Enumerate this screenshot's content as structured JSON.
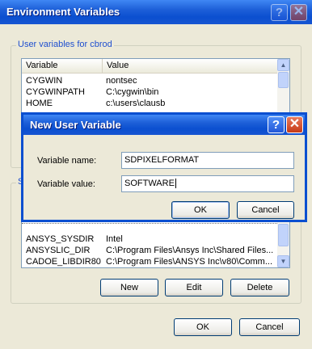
{
  "main_window": {
    "title": "Environment Variables",
    "help_glyph": "?",
    "close_glyph": "✕",
    "user_group_title": "User variables for cbrod",
    "user_columns": [
      "Variable",
      "Value"
    ],
    "user_rows": [
      {
        "variable": "CYGWIN",
        "value": "nontsec"
      },
      {
        "variable": "CYGWINPATH",
        "value": "C:\\cygwin\\bin"
      },
      {
        "variable": "HOME",
        "value": "c:\\users\\clausb"
      }
    ],
    "system_group_title": "Sy",
    "system_rows": [
      {
        "variable": "ANSYS_SYSDIR",
        "value": "Intel"
      },
      {
        "variable": "ANSYSLIC_DIR",
        "value": "C:\\Program Files\\Ansys Inc\\Shared Files..."
      },
      {
        "variable": "CADOE_LIBDIR80",
        "value": "C:\\Program Files\\ANSYS Inc\\v80\\Comm..."
      }
    ],
    "buttons": {
      "new": "New",
      "edit": "Edit",
      "delete": "Delete",
      "ok": "OK",
      "cancel": "Cancel"
    }
  },
  "dialog": {
    "title": "New User Variable",
    "help_glyph": "?",
    "close_glyph": "✕",
    "name_label": "Variable name:",
    "name_value": "SDPIXELFORMAT",
    "value_label": "Variable value:",
    "value_value": "SOFTWARE",
    "ok_label": "OK",
    "cancel_label": "Cancel"
  },
  "scroll_arrows": {
    "up": "▲",
    "down": "▼"
  }
}
